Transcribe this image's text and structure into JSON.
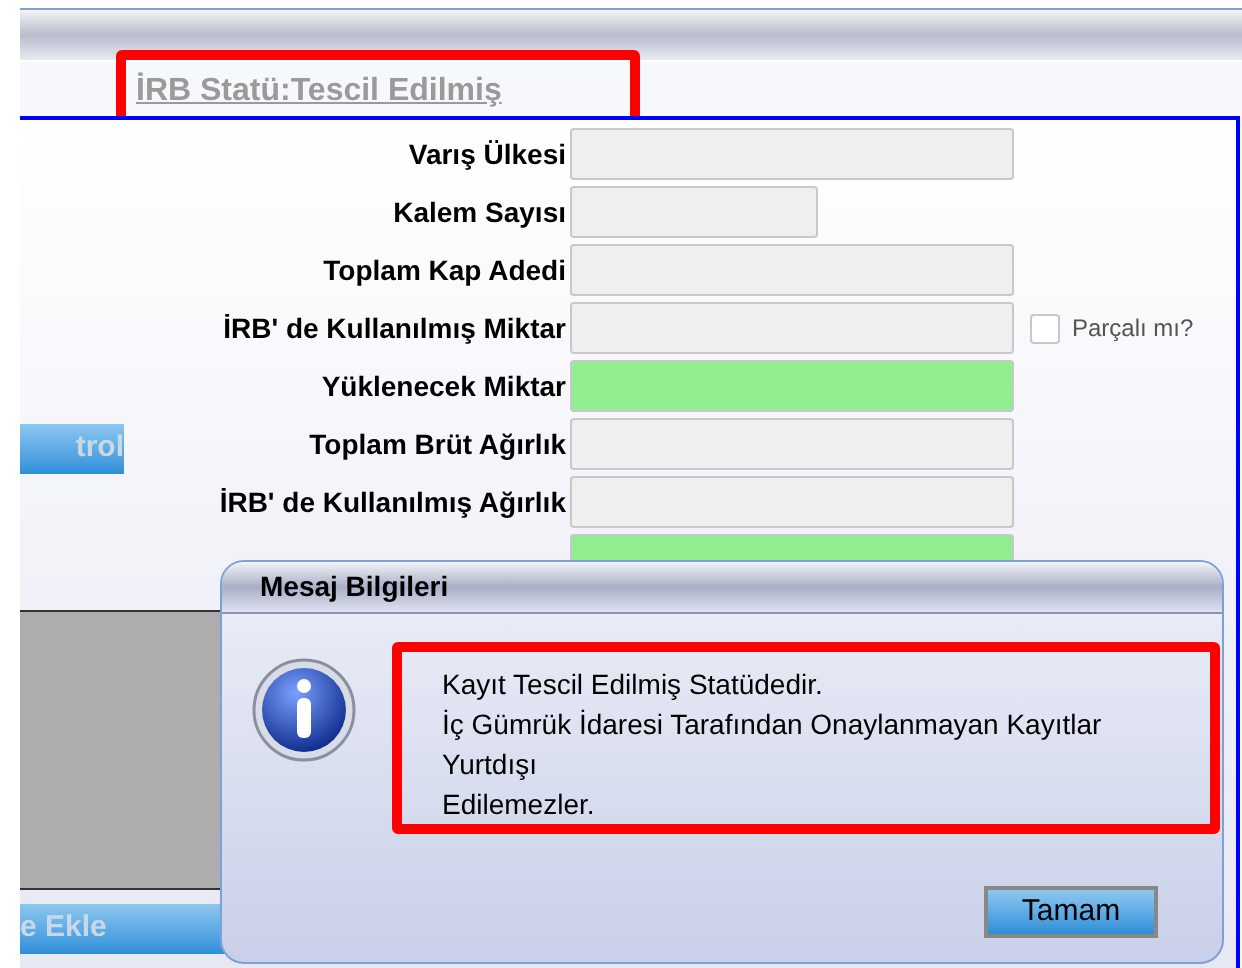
{
  "status_link": "İRB Statü:Tescil Edilmiş",
  "form": [
    {
      "label": "Varış Ülkesi",
      "kind": "wide",
      "highlighted": false
    },
    {
      "label": "Kalem Sayısı",
      "kind": "short",
      "highlighted": false
    },
    {
      "label": "Toplam Kap Adedi",
      "kind": "wide",
      "highlighted": false
    },
    {
      "label": "İRB' de Kullanılmış Miktar",
      "kind": "wide",
      "highlighted": false,
      "checkbox": {
        "label": "Parçalı mı?",
        "checked": false
      }
    },
    {
      "label": "Yüklenecek Miktar",
      "kind": "wide",
      "highlighted": true
    },
    {
      "label": "Toplam Brüt Ağırlık",
      "kind": "wide",
      "highlighted": false
    },
    {
      "label": "İRB' de Kullanılmış Ağırlık",
      "kind": "wide",
      "highlighted": false
    },
    {
      "kind": "wide",
      "highlighted": true
    }
  ],
  "side_buttons": [
    "trol",
    "e Ekle"
  ],
  "dialog": {
    "title": "Mesaj Bilgileri",
    "message": [
      "Kayıt Tescil Edilmiş Statüdedir.",
      "İç Gümrük İdaresi Tarafından Onaylanmayan Kayıtlar",
      "Yurtdışı",
      "Edilemezler."
    ],
    "button": "Tamam"
  }
}
